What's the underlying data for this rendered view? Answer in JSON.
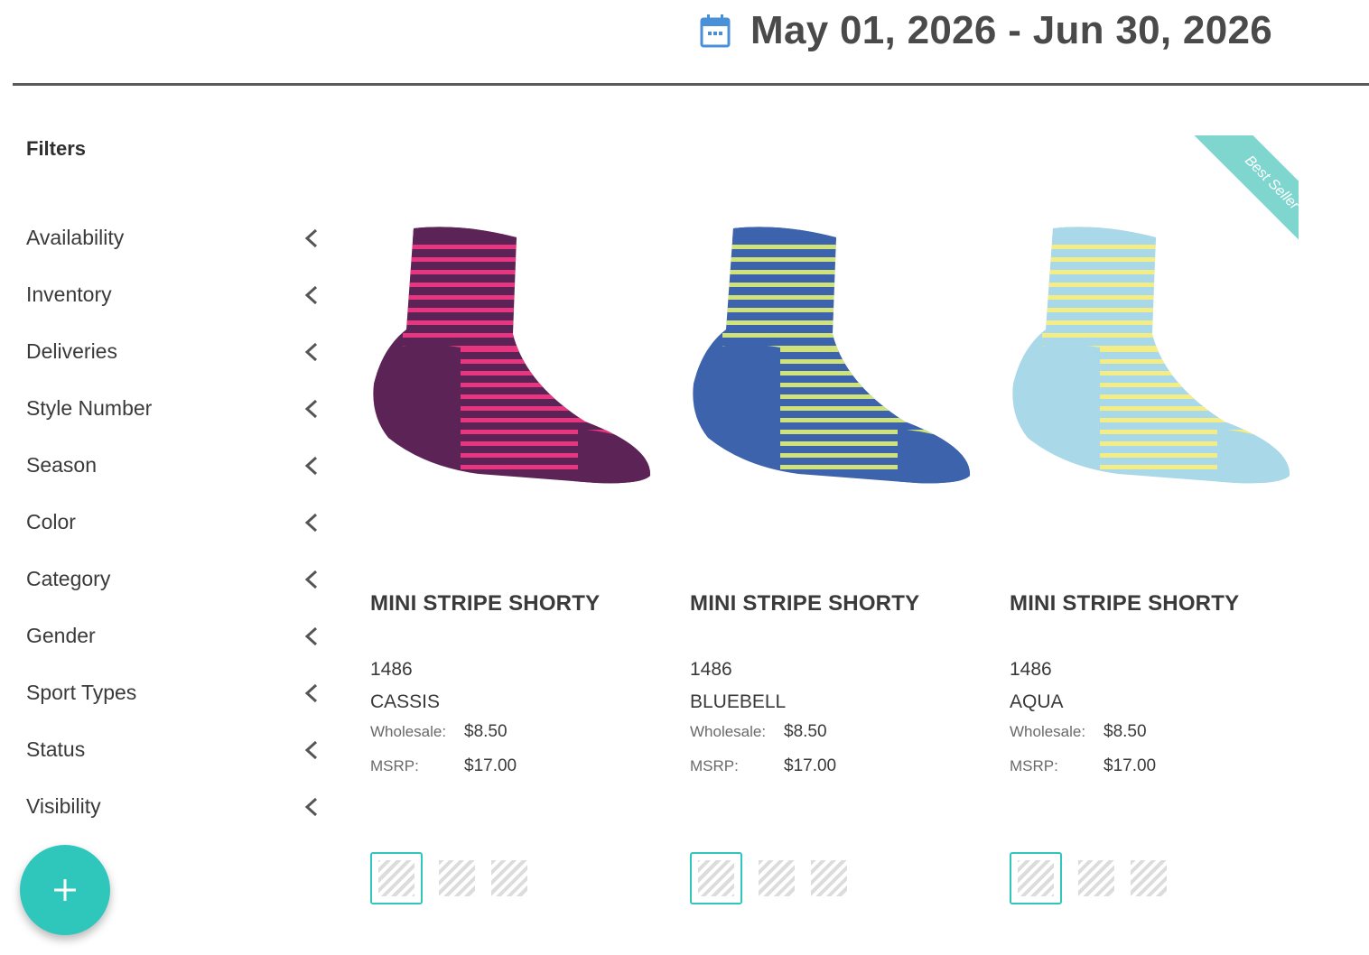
{
  "header": {
    "date_range": "May 01, 2026 - Jun 30, 2026",
    "calendar_icon": "calendar-icon"
  },
  "sidebar": {
    "title": "Filters",
    "chevron_icon": "chevron-left-icon",
    "items": [
      {
        "label": "Availability"
      },
      {
        "label": "Inventory"
      },
      {
        "label": "Deliveries"
      },
      {
        "label": "Style Number"
      },
      {
        "label": "Season"
      },
      {
        "label": "Color"
      },
      {
        "label": "Category"
      },
      {
        "label": "Gender"
      },
      {
        "label": "Sport Types"
      },
      {
        "label": "Status"
      },
      {
        "label": "Visibility"
      }
    ]
  },
  "fab": {
    "icon": "plus-icon",
    "color": "#2fc7bc"
  },
  "products": [
    {
      "name": "MINI STRIPE SHORTY",
      "style_number": "1486",
      "color": "CASSIS",
      "wholesale_label": "Wholesale:",
      "wholesale": "$8.50",
      "msrp_label": "MSRP:",
      "msrp": "$17.00",
      "sock_base": "#5c2456",
      "sock_stripe": "#e8357f",
      "badge": null,
      "swatch_count": 3
    },
    {
      "name": "MINI STRIPE SHORTY",
      "style_number": "1486",
      "color": "BLUEBELL",
      "wholesale_label": "Wholesale:",
      "wholesale": "$8.50",
      "msrp_label": "MSRP:",
      "msrp": "$17.00",
      "sock_base": "#3c63ac",
      "sock_stripe": "#cfe37a",
      "badge": null,
      "swatch_count": 3
    },
    {
      "name": "MINI STRIPE SHORTY",
      "style_number": "1486",
      "color": "AQUA",
      "wholesale_label": "Wholesale:",
      "wholesale": "$8.50",
      "msrp_label": "MSRP:",
      "msrp": "$17.00",
      "sock_base": "#a9d8e8",
      "sock_stripe": "#f4ec84",
      "badge": "Best Seller",
      "swatch_count": 3
    }
  ],
  "colors": {
    "accent": "#2fc7bc",
    "ribbon": "#7fd6cf"
  }
}
